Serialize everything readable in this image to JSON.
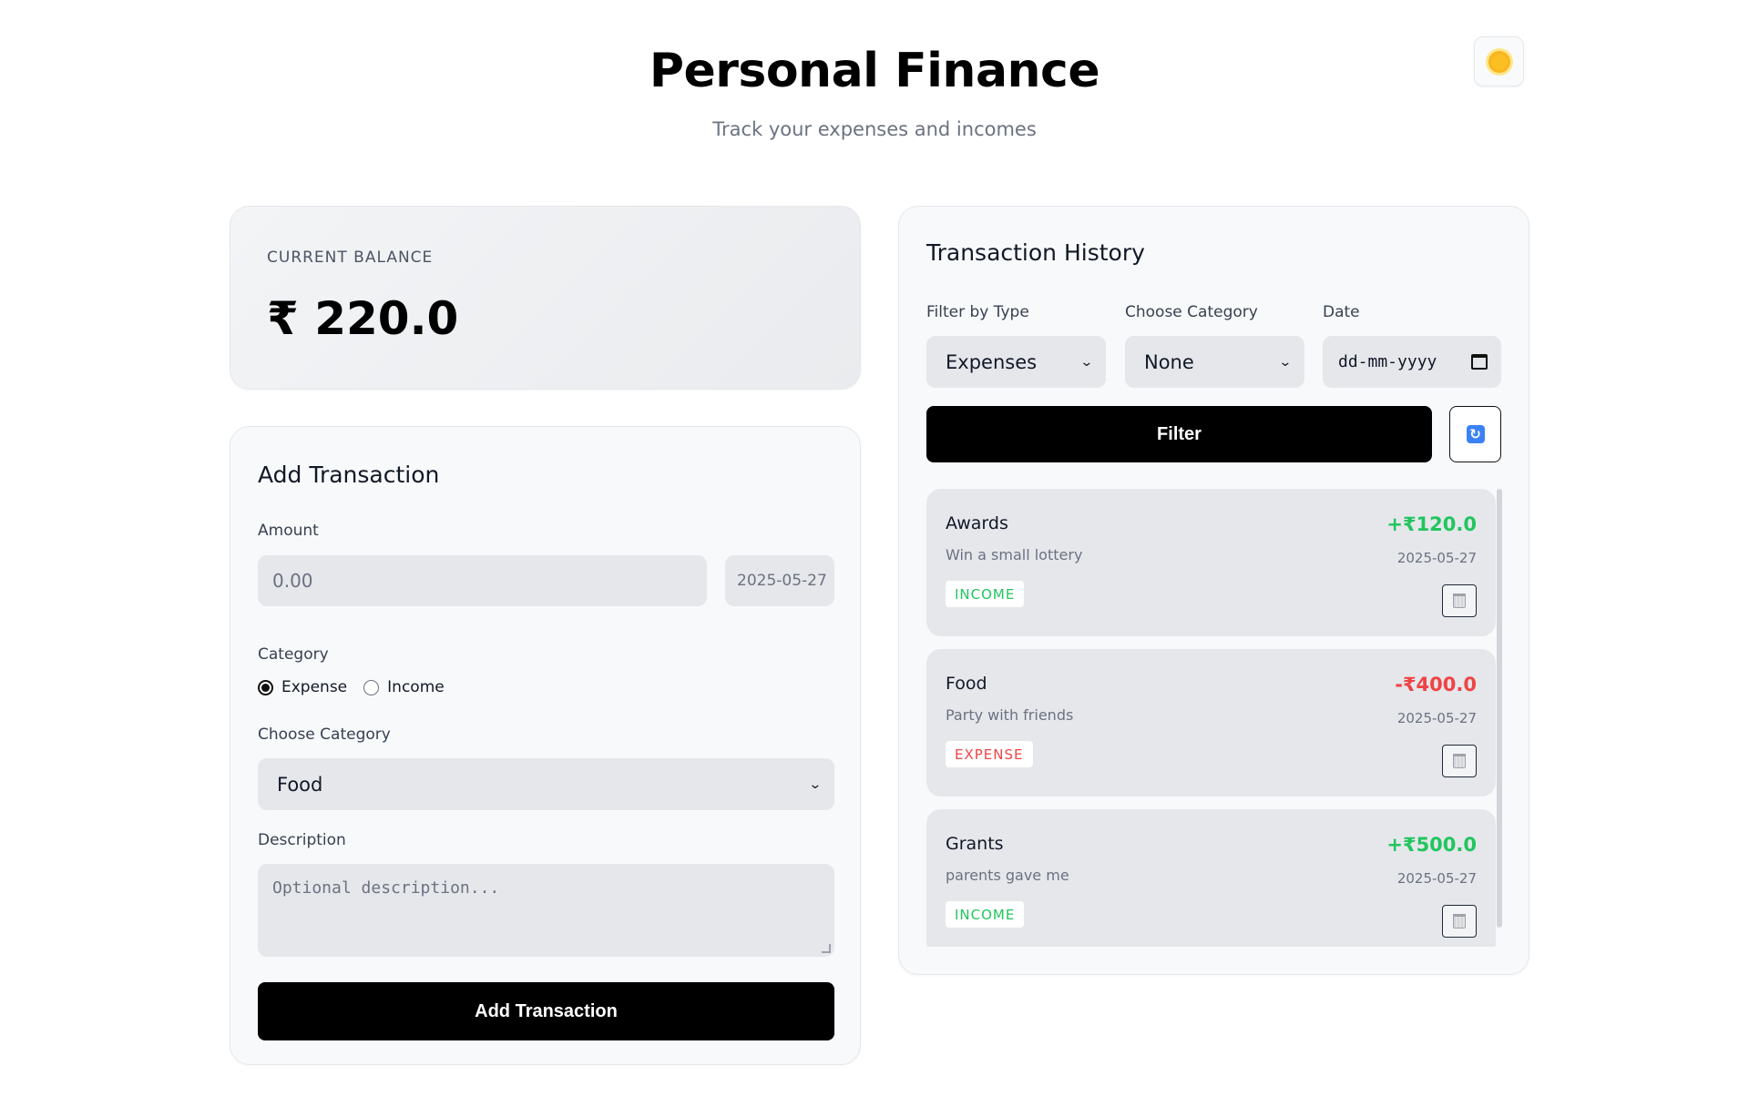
{
  "header": {
    "title": "Personal Finance",
    "subtitle": "Track your expenses and incomes"
  },
  "balance": {
    "label": "CURRENT BALANCE",
    "value": "₹ 220.0"
  },
  "add_form": {
    "title": "Add Transaction",
    "amount_label": "Amount",
    "amount_placeholder": "0.00",
    "date_value": "2025-05-27",
    "category_label": "Category",
    "type_options": [
      {
        "label": "Expense",
        "selected": true
      },
      {
        "label": "Income",
        "selected": false
      }
    ],
    "choose_category_label": "Choose Category",
    "category_selected": "Food",
    "description_label": "Description",
    "description_placeholder": "Optional description...",
    "submit_label": "Add Transaction"
  },
  "history": {
    "title": "Transaction History",
    "filter_type_label": "Filter by Type",
    "filter_type_value": "Expenses",
    "filter_category_label": "Choose Category",
    "filter_category_value": "None",
    "date_label": "Date",
    "date_placeholder": "dd-mm-yyyy",
    "filter_button": "Filter",
    "transactions": [
      {
        "name": "Awards",
        "description": "Win a small lottery",
        "amount": "+₹120.0",
        "date": "2025-05-27",
        "type": "INCOME"
      },
      {
        "name": "Food",
        "description": "Party with friends",
        "amount": "-₹400.0",
        "date": "2025-05-27",
        "type": "EXPENSE"
      },
      {
        "name": "Grants",
        "description": "parents gave me",
        "amount": "+₹500.0",
        "date": "2025-05-27",
        "type": "INCOME"
      }
    ]
  },
  "colors": {
    "income": "#22c55e",
    "expense": "#ef4444",
    "primary_button": "#000000"
  },
  "icons": {
    "theme": "sun-icon",
    "refresh": "refresh-icon",
    "delete": "trash-icon",
    "calendar": "calendar-icon",
    "dropdown": "chevron-down-icon"
  }
}
